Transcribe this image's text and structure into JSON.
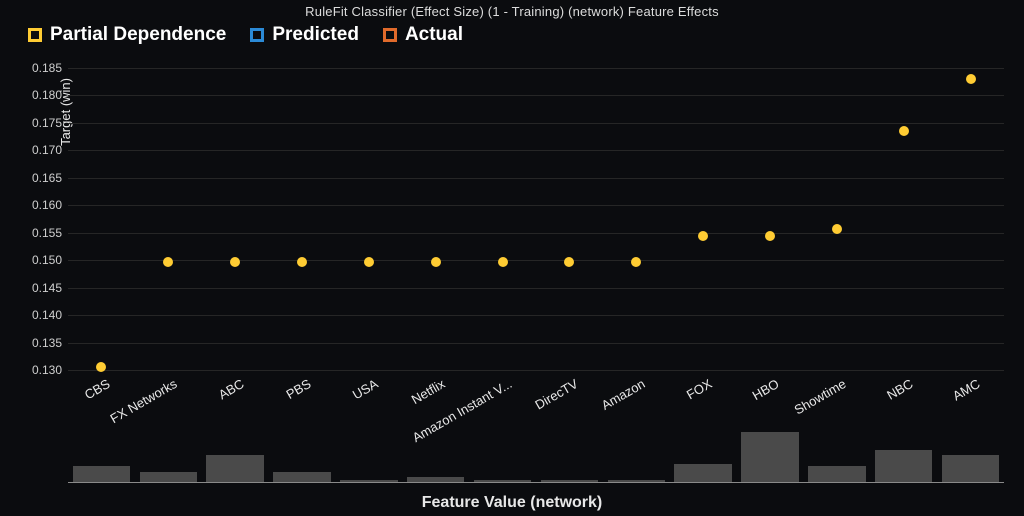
{
  "title": "RuleFit Classifier (Effect Size) (1 - Training) (network) Feature Effects",
  "legend": {
    "partial": "Partial Dependence",
    "predicted": "Predicted",
    "actual": "Actual"
  },
  "ylabel": "Target (win)",
  "xlabel": "Feature Value (network)",
  "chart_data": {
    "type": "scatter",
    "ylim": [
      0.13,
      0.185
    ],
    "yticks": [
      0.13,
      0.135,
      0.14,
      0.145,
      0.15,
      0.155,
      0.16,
      0.165,
      0.17,
      0.175,
      0.18,
      0.185
    ],
    "categories": [
      "CBS",
      "FX Networks",
      "ABC",
      "PBS",
      "USA",
      "Netflix",
      "Amazon Instant V...",
      "DirecTV",
      "Amazon",
      "FOX",
      "HBO",
      "Showtime",
      "NBC",
      "AMC"
    ],
    "series": [
      {
        "name": "Partial Dependence",
        "color": "#ffcc33",
        "values": [
          0.1305,
          0.1497,
          0.1497,
          0.1497,
          0.1497,
          0.1497,
          0.1497,
          0.1497,
          0.1497,
          0.1544,
          0.1544,
          0.1557,
          0.1735,
          0.183
        ]
      }
    ],
    "distribution_bars": [
      0.33,
      0.2,
      0.55,
      0.2,
      0.05,
      0.1,
      0.05,
      0.05,
      0.05,
      0.37,
      1.0,
      0.33,
      0.64,
      0.55
    ]
  }
}
